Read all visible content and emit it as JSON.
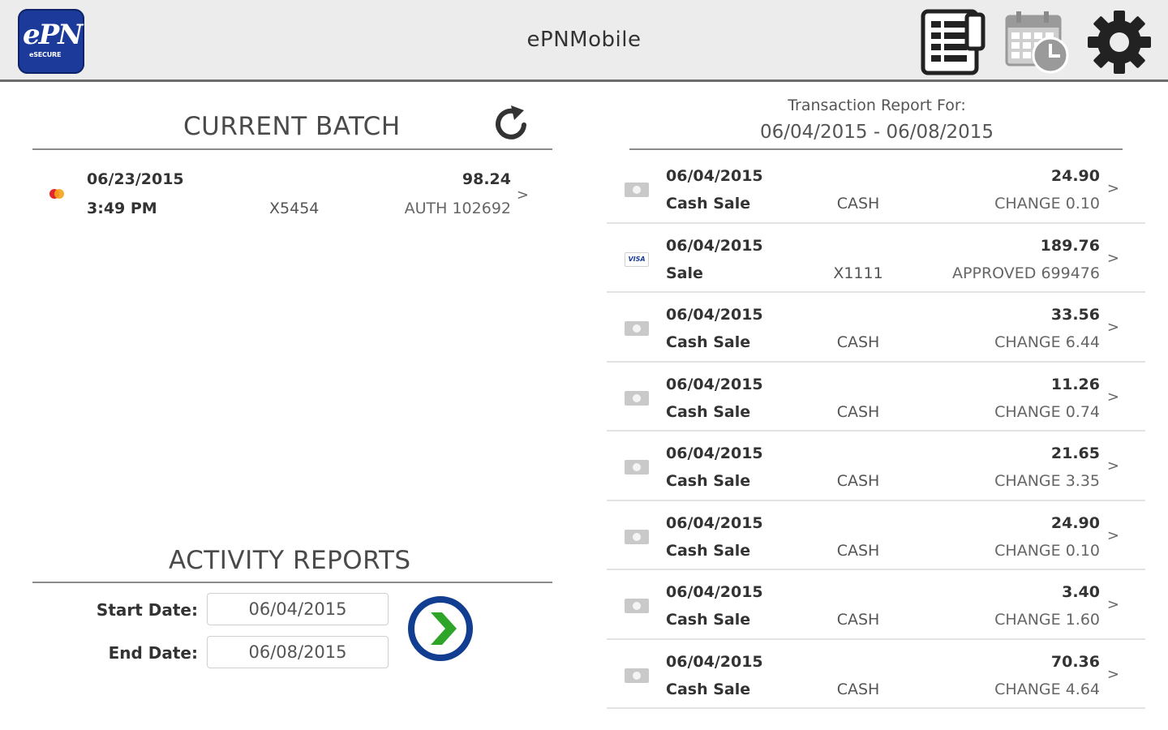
{
  "app": {
    "title": "ePNMobile",
    "logo_text": "ePN",
    "logo_subtext": "eSECURE"
  },
  "header_icons": [
    {
      "name": "reports-icon",
      "label": "Reports"
    },
    {
      "name": "calendar-clock-icon",
      "label": "Schedule"
    },
    {
      "name": "gear-icon",
      "label": "Settings"
    }
  ],
  "current_batch": {
    "title": "CURRENT BATCH",
    "items": [
      {
        "date": "06/23/2015",
        "time": "3:49 PM",
        "card": "X5454",
        "amount": "98.24",
        "auth": "AUTH 102692",
        "card_type": "mastercard"
      }
    ]
  },
  "activity_reports": {
    "title": "ACTIVITY REPORTS",
    "start_label": "Start Date:",
    "start_value": "06/04/2015",
    "end_label": "End Date:",
    "end_value": "06/08/2015"
  },
  "report": {
    "heading": "Transaction Report For:",
    "range": "06/04/2015 - 06/08/2015",
    "transactions": [
      {
        "date": "06/04/2015",
        "type": "Cash Sale",
        "method": "CASH",
        "amount": "24.90",
        "note": "CHANGE 0.10",
        "icon": "cash-icon"
      },
      {
        "date": "06/04/2015",
        "type": "Sale",
        "method": "X1111",
        "amount": "189.76",
        "note": "APPROVED 699476",
        "icon": "visa-icon"
      },
      {
        "date": "06/04/2015",
        "type": "Cash Sale",
        "method": "CASH",
        "amount": "33.56",
        "note": "CHANGE 6.44",
        "icon": "cash-icon"
      },
      {
        "date": "06/04/2015",
        "type": "Cash Sale",
        "method": "CASH",
        "amount": "11.26",
        "note": "CHANGE 0.74",
        "icon": "cash-icon"
      },
      {
        "date": "06/04/2015",
        "type": "Cash Sale",
        "method": "CASH",
        "amount": "21.65",
        "note": "CHANGE 3.35",
        "icon": "cash-icon"
      },
      {
        "date": "06/04/2015",
        "type": "Cash Sale",
        "method": "CASH",
        "amount": "24.90",
        "note": "CHANGE 0.10",
        "icon": "cash-icon"
      },
      {
        "date": "06/04/2015",
        "type": "Cash Sale",
        "method": "CASH",
        "amount": "3.40",
        "note": "CHANGE 1.60",
        "icon": "cash-icon"
      },
      {
        "date": "06/04/2015",
        "type": "Cash Sale",
        "method": "CASH",
        "amount": "70.36",
        "note": "CHANGE 4.64",
        "icon": "cash-icon"
      }
    ]
  },
  "colors": {
    "brand": "#1b3a9a",
    "go_ring": "#123e92",
    "go_arrow": "#2ea428",
    "header_bg": "#ececec"
  },
  "chevron": ">",
  "visa_text": "VISA"
}
